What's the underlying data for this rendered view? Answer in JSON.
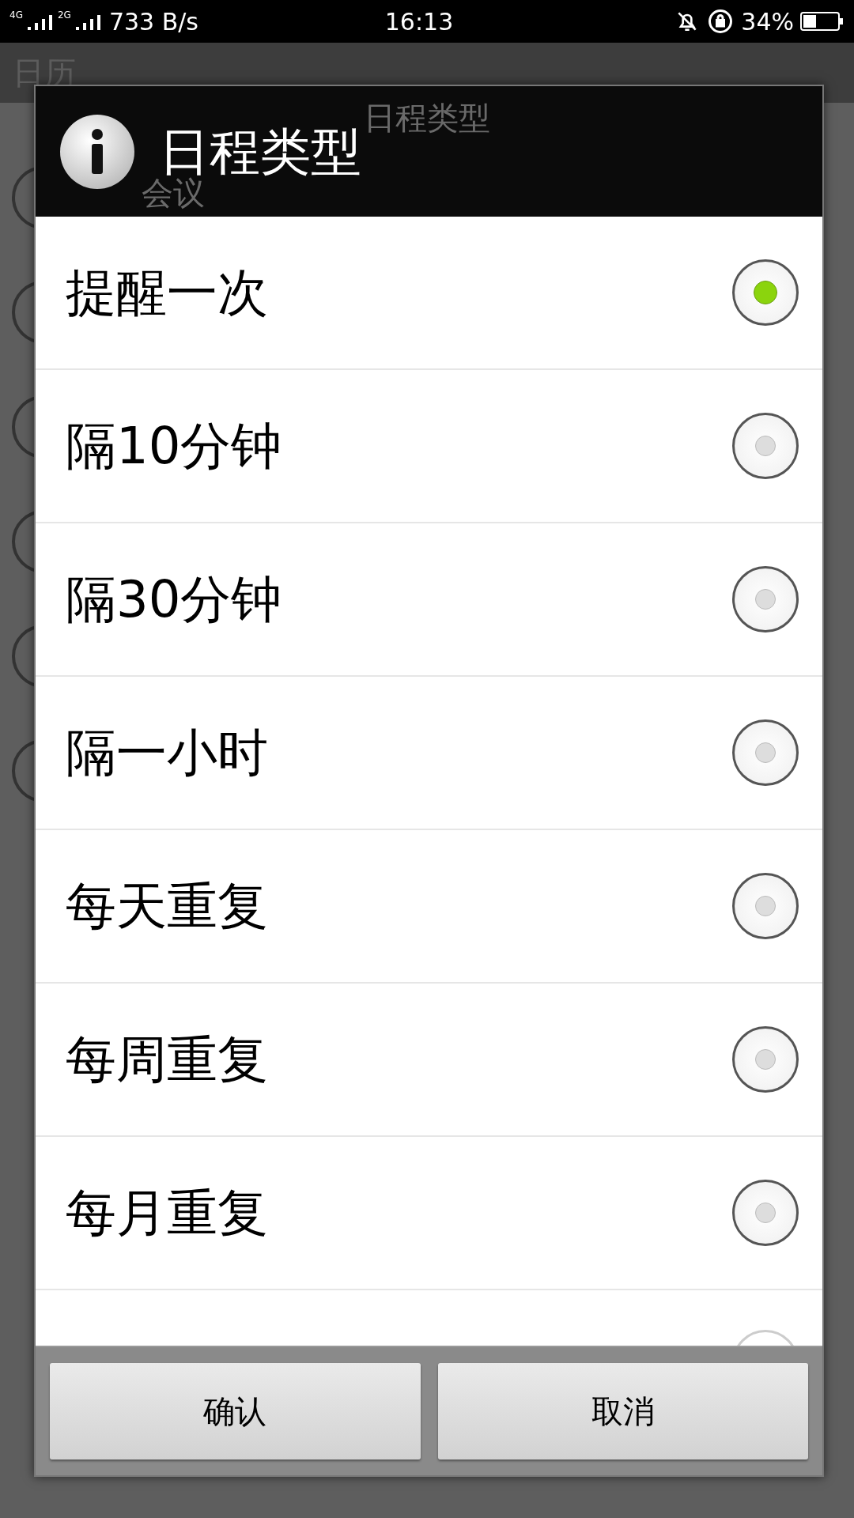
{
  "status_bar": {
    "network_1": "4G",
    "network_2": "2G",
    "speed": "733 B/s",
    "time": "16:13",
    "battery": "34%"
  },
  "background": {
    "title": "日历",
    "ghost_title": "日程类型",
    "first_item": "会议"
  },
  "dialog": {
    "title": "日程类型",
    "options": [
      {
        "label": "提醒一次",
        "selected": true
      },
      {
        "label": "隔10分钟",
        "selected": false
      },
      {
        "label": "隔30分钟",
        "selected": false
      },
      {
        "label": "隔一小时",
        "selected": false
      },
      {
        "label": "每天重复",
        "selected": false
      },
      {
        "label": "每周重复",
        "selected": false
      },
      {
        "label": "每月重复",
        "selected": false
      }
    ],
    "partial_option": {
      "selected": false
    },
    "buttons": [
      "确认",
      "取消"
    ]
  }
}
